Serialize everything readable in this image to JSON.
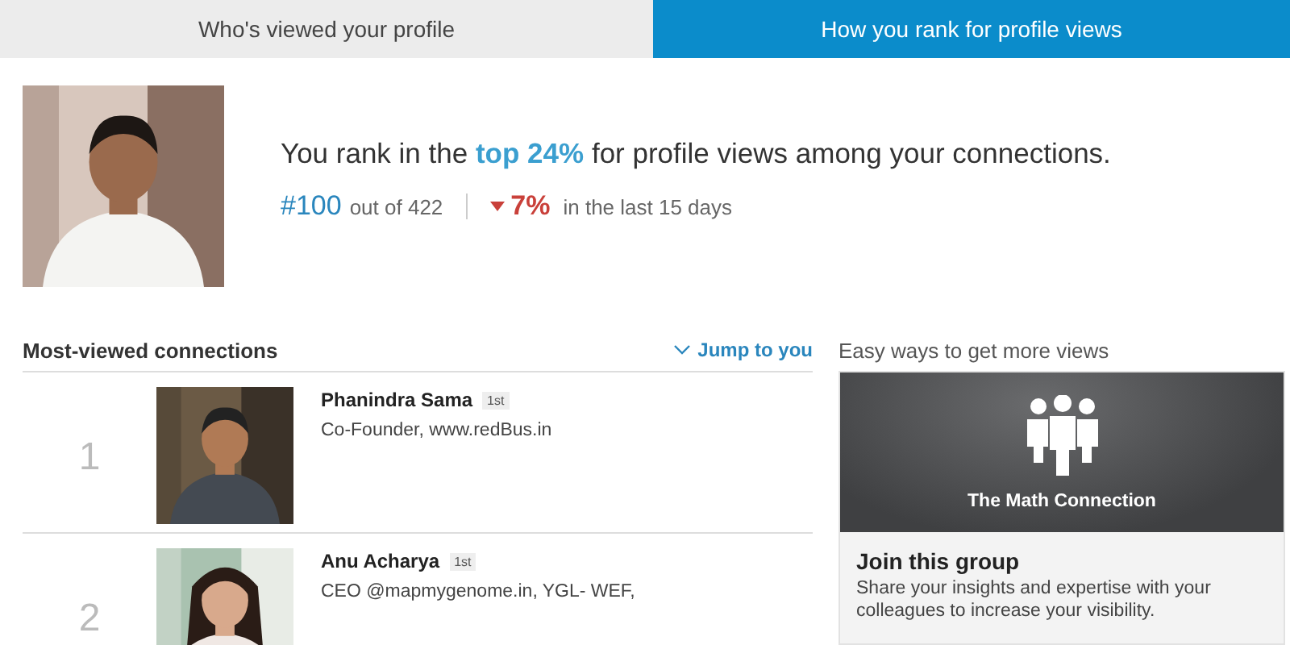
{
  "tabs": [
    {
      "label": "Who's viewed your profile",
      "selected": false
    },
    {
      "label": "How you rank for profile views",
      "selected": true
    }
  ],
  "summary": {
    "headline": "You rank in the **top 24%** for profile views among your connections.",
    "rank": "#100",
    "rank_total": "out of 422",
    "change": {
      "decreased": true,
      "value": "7%"
    },
    "change_period": "in the last 15 days"
  },
  "connections": {
    "title": "Most-viewed connections",
    "jump_link": "Jump to you",
    "rows": [
      {
        "rank": "1",
        "name": "Phanindra Sama",
        "degree": "1st",
        "headline": "Co-Founder, www.redBus.in"
      },
      {
        "rank": "2",
        "name": "Anu Acharya",
        "degree": "1st",
        "headline": "CEO @mapmygenome.in, YGL- WEF,"
      }
    ]
  },
  "suggestions": {
    "title": "Easy ways to get more views",
    "card": {
      "group_name": "The Math Connection",
      "action": "Join this group",
      "description": "Share your insights and expertise with your colleagues to increase your visibility."
    }
  }
}
